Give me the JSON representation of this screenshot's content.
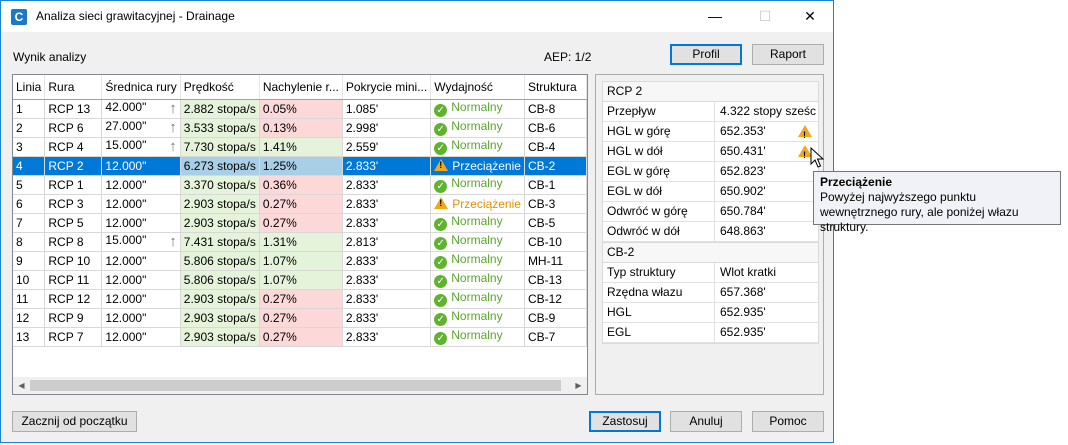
{
  "window": {
    "title": "Analiza sieci grawitacyjnej - Drainage",
    "app_icon": "C",
    "controls": {
      "minimize": "—",
      "maximize": "☐",
      "close": "✕"
    }
  },
  "header": {
    "results_label": "Wynik analizy",
    "aep": "AEP: 1/2",
    "profile_button": "Profil",
    "report_button": "Raport"
  },
  "grid": {
    "columns": [
      "Linia",
      "Rura",
      "Średnica rury",
      "Prędkość",
      "Nachylenie r...",
      "Pokrycie mini...",
      "Wydajność",
      "Struktura"
    ],
    "rows": [
      {
        "line": "1",
        "pipe": "RCP 13",
        "diameter": "42.000\"",
        "arrow": true,
        "velocity": "2.882 stopa/s",
        "slope": "0.05%",
        "slope_status": "r",
        "cover": "1.085'",
        "capacity": "Normalny",
        "capacity_status": "ok",
        "structure": "CB-8",
        "selected": false
      },
      {
        "line": "2",
        "pipe": "RCP 6",
        "diameter": "27.000\"",
        "arrow": true,
        "velocity": "3.533 stopa/s",
        "slope": "0.13%",
        "slope_status": "r",
        "cover": "2.998'",
        "capacity": "Normalny",
        "capacity_status": "ok",
        "structure": "CB-6",
        "selected": false
      },
      {
        "line": "3",
        "pipe": "RCP 4",
        "diameter": "15.000\"",
        "arrow": true,
        "velocity": "7.730 stopa/s",
        "slope": "1.41%",
        "slope_status": "g",
        "cover": "2.559'",
        "capacity": "Normalny",
        "capacity_status": "ok",
        "structure": "CB-4",
        "selected": false
      },
      {
        "line": "4",
        "pipe": "RCP 2",
        "diameter": "12.000\"",
        "arrow": false,
        "velocity": "6.273 stopa/s",
        "slope": "1.25%",
        "slope_status": "g",
        "cover": "2.833'",
        "capacity": "Przeciążenie",
        "capacity_status": "warn",
        "structure": "CB-2",
        "selected": true
      },
      {
        "line": "5",
        "pipe": "RCP 1",
        "diameter": "12.000\"",
        "arrow": false,
        "velocity": "3.370 stopa/s",
        "slope": "0.36%",
        "slope_status": "r",
        "cover": "2.833'",
        "capacity": "Normalny",
        "capacity_status": "ok",
        "structure": "CB-1",
        "selected": false
      },
      {
        "line": "6",
        "pipe": "RCP 3",
        "diameter": "12.000\"",
        "arrow": false,
        "velocity": "2.903 stopa/s",
        "slope": "0.27%",
        "slope_status": "r",
        "cover": "2.833'",
        "capacity": "Przeciążenie",
        "capacity_status": "warn",
        "structure": "CB-3",
        "selected": false
      },
      {
        "line": "7",
        "pipe": "RCP 5",
        "diameter": "12.000\"",
        "arrow": false,
        "velocity": "2.903 stopa/s",
        "slope": "0.27%",
        "slope_status": "r",
        "cover": "2.833'",
        "capacity": "Normalny",
        "capacity_status": "ok",
        "structure": "CB-5",
        "selected": false
      },
      {
        "line": "8",
        "pipe": "RCP 8",
        "diameter": "15.000\"",
        "arrow": true,
        "velocity": "7.431 stopa/s",
        "slope": "1.31%",
        "slope_status": "g",
        "cover": "2.813'",
        "capacity": "Normalny",
        "capacity_status": "ok",
        "structure": "CB-10",
        "selected": false
      },
      {
        "line": "9",
        "pipe": "RCP 10",
        "diameter": "12.000\"",
        "arrow": false,
        "velocity": "5.806 stopa/s",
        "slope": "1.07%",
        "slope_status": "g",
        "cover": "2.833'",
        "capacity": "Normalny",
        "capacity_status": "ok",
        "structure": "MH-11",
        "selected": false
      },
      {
        "line": "10",
        "pipe": "RCP 11",
        "diameter": "12.000\"",
        "arrow": false,
        "velocity": "5.806 stopa/s",
        "slope": "1.07%",
        "slope_status": "g",
        "cover": "2.833'",
        "capacity": "Normalny",
        "capacity_status": "ok",
        "structure": "CB-13",
        "selected": false
      },
      {
        "line": "11",
        "pipe": "RCP 12",
        "diameter": "12.000\"",
        "arrow": false,
        "velocity": "2.903 stopa/s",
        "slope": "0.27%",
        "slope_status": "r",
        "cover": "2.833'",
        "capacity": "Normalny",
        "capacity_status": "ok",
        "structure": "CB-12",
        "selected": false
      },
      {
        "line": "12",
        "pipe": "RCP 9",
        "diameter": "12.000\"",
        "arrow": false,
        "velocity": "2.903 stopa/s",
        "slope": "0.27%",
        "slope_status": "r",
        "cover": "2.833'",
        "capacity": "Normalny",
        "capacity_status": "ok",
        "structure": "CB-9",
        "selected": false
      },
      {
        "line": "13",
        "pipe": "RCP 7",
        "diameter": "12.000\"",
        "arrow": false,
        "velocity": "2.903 stopa/s",
        "slope": "0.27%",
        "slope_status": "r",
        "cover": "2.833'",
        "capacity": "Normalny",
        "capacity_status": "ok",
        "structure": "CB-7",
        "selected": false
      }
    ]
  },
  "pipe_panel": {
    "title": "RCP 2",
    "rows": [
      {
        "key": "Przepływ",
        "value": "4.322 stopy sześci...",
        "warn": false
      },
      {
        "key": "HGL w górę",
        "value": "652.353'",
        "warn": true
      },
      {
        "key": "HGL w dół",
        "value": "650.431'",
        "warn": true
      },
      {
        "key": "EGL w górę",
        "value": "652.823'",
        "warn": false
      },
      {
        "key": "EGL w dół",
        "value": "650.902'",
        "warn": false
      },
      {
        "key": "Odwróć w górę",
        "value": "650.784'",
        "warn": false
      },
      {
        "key": "Odwróć w dół",
        "value": "648.863'",
        "warn": false
      }
    ]
  },
  "structure_panel": {
    "title": "CB-2",
    "rows": [
      {
        "key": "Typ struktury",
        "value": "Wlot kratki"
      },
      {
        "key": "Rzędna włazu",
        "value": "657.368'"
      },
      {
        "key": "HGL",
        "value": "652.935'"
      },
      {
        "key": "EGL",
        "value": "652.935'"
      }
    ]
  },
  "tooltip": {
    "title": "Przeciążenie",
    "text": "Powyżej najwyższego punktu wewnętrznego rury, ale poniżej włazu struktury."
  },
  "footer": {
    "start_over": "Zacznij od początku",
    "apply": "Zastosuj",
    "cancel": "Anuluj",
    "help": "Pomoc"
  },
  "colors": {
    "accent": "#0078d7",
    "ok": "#5fb32e",
    "warn": "#f2a81d",
    "good_cell": "#e4f3d9",
    "bad_cell": "#fcd8d8"
  }
}
